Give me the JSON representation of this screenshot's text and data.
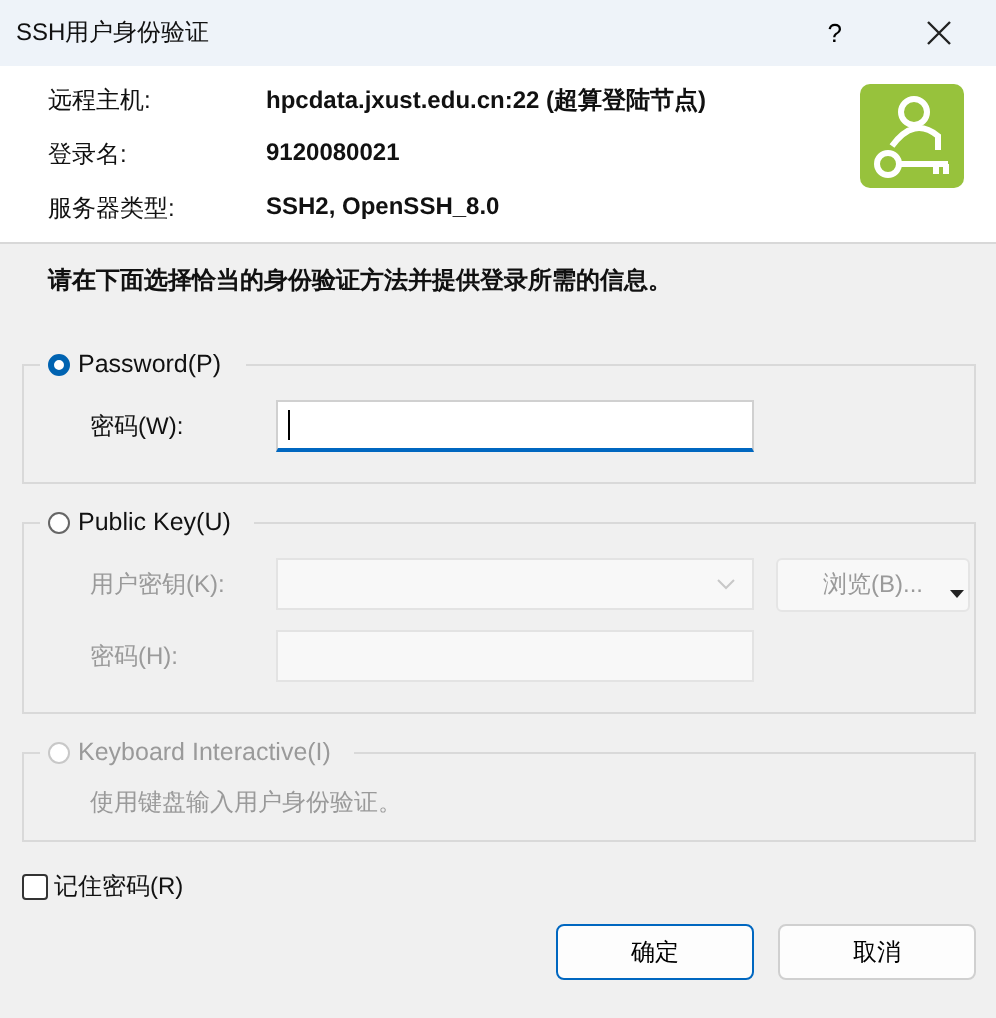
{
  "window": {
    "title": "SSH用户身份验证",
    "help": "?"
  },
  "info": [
    {
      "label": "远程主机:",
      "value": "hpcdata.jxust.edu.cn:22 (超算登陆节点)"
    },
    {
      "label": "登录名:",
      "value": "9120080021"
    },
    {
      "label": "服务器类型:",
      "value": "SSH2, OpenSSH_8.0"
    }
  ],
  "instruction": "请在下面选择恰当的身份验证方法并提供登录所需的信息。",
  "methods": [
    {
      "label": "Password(P)",
      "selected": true,
      "disabled": false,
      "fields": [
        {
          "kind": "text",
          "label": "密码(W):",
          "disabled": false,
          "focused": true
        }
      ]
    },
    {
      "label": "Public Key(U)",
      "selected": false,
      "disabled": false,
      "fields": [
        {
          "kind": "dropdown",
          "label": "用户密钥(K):",
          "disabled": true,
          "button": "浏览(B)..."
        },
        {
          "kind": "text",
          "label": "密码(H):",
          "disabled": true,
          "focused": false
        }
      ]
    },
    {
      "label": "Keyboard Interactive(I)",
      "selected": false,
      "disabled": true,
      "note": "使用键盘输入用户身份验证。"
    }
  ],
  "remember": {
    "label": "记住密码(R)",
    "checked": false
  },
  "buttons": [
    {
      "label": "确定",
      "default": true
    },
    {
      "label": "取消",
      "default": false
    }
  ]
}
